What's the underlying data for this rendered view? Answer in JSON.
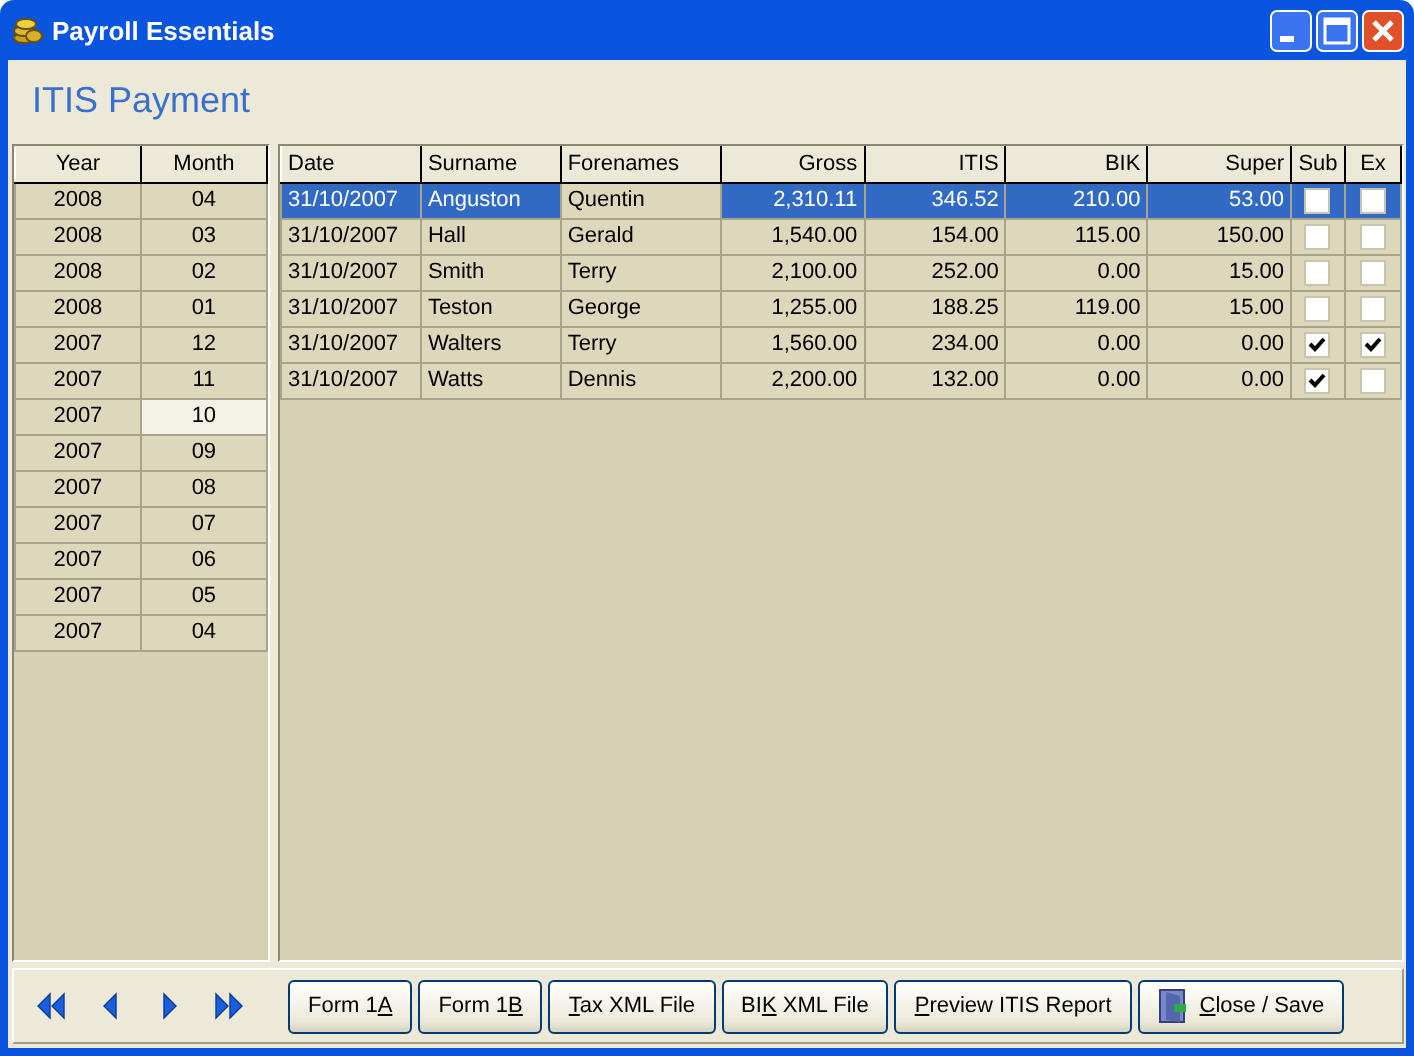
{
  "window": {
    "title": "Payroll Essentials"
  },
  "heading": "ITIS Payment",
  "periods": {
    "columns": [
      {
        "label": "Year",
        "focused": false
      },
      {
        "label": "Month",
        "focused": true
      }
    ],
    "rows": [
      {
        "cells": [
          "2008",
          "04"
        ],
        "selected": false
      },
      {
        "cells": [
          "2008",
          "03"
        ],
        "selected": false
      },
      {
        "cells": [
          "2008",
          "02"
        ],
        "selected": false
      },
      {
        "cells": [
          "2008",
          "01"
        ],
        "selected": false
      },
      {
        "cells": [
          "2007",
          "12"
        ],
        "selected": false
      },
      {
        "cells": [
          "2007",
          "11"
        ],
        "selected": false
      },
      {
        "cells": [
          "2007",
          "10"
        ],
        "selected": true
      },
      {
        "cells": [
          "2007",
          "09"
        ],
        "selected": false
      },
      {
        "cells": [
          "2007",
          "08"
        ],
        "selected": false
      },
      {
        "cells": [
          "2007",
          "07"
        ],
        "selected": false
      },
      {
        "cells": [
          "2007",
          "06"
        ],
        "selected": false
      },
      {
        "cells": [
          "2007",
          "05"
        ],
        "selected": false
      },
      {
        "cells": [
          "2007",
          "04"
        ],
        "selected": false
      }
    ]
  },
  "payments": {
    "columns": [
      {
        "label": "Date",
        "focused": false,
        "kind": "text"
      },
      {
        "label": "Surname",
        "focused": false,
        "kind": "text"
      },
      {
        "label": "Forenames",
        "focused": true,
        "kind": "text"
      },
      {
        "label": "Gross",
        "focused": false,
        "kind": "amount"
      },
      {
        "label": "ITIS",
        "focused": false,
        "kind": "amount"
      },
      {
        "label": "BIK",
        "focused": false,
        "kind": "amount"
      },
      {
        "label": "Super",
        "focused": false,
        "kind": "amount"
      },
      {
        "label": "Sub",
        "focused": false,
        "kind": "flag"
      },
      {
        "label": "Ex",
        "focused": false,
        "kind": "flag"
      }
    ],
    "rows": [
      {
        "cells": [
          "31/10/2007",
          "Anguston",
          "Quentin",
          "2,310.11",
          "346.52",
          "210.00",
          "53.00"
        ],
        "sub": false,
        "ex": false,
        "selected": true
      },
      {
        "cells": [
          "31/10/2007",
          "Hall",
          "Gerald",
          "1,540.00",
          "154.00",
          "115.00",
          "150.00"
        ],
        "sub": false,
        "ex": false,
        "selected": false
      },
      {
        "cells": [
          "31/10/2007",
          "Smith",
          "Terry",
          "2,100.00",
          "252.00",
          "0.00",
          "15.00"
        ],
        "sub": false,
        "ex": false,
        "selected": false
      },
      {
        "cells": [
          "31/10/2007",
          "Teston",
          "George",
          "1,255.00",
          "188.25",
          "119.00",
          "15.00"
        ],
        "sub": false,
        "ex": false,
        "selected": false
      },
      {
        "cells": [
          "31/10/2007",
          "Walters",
          "Terry",
          "1,560.00",
          "234.00",
          "0.00",
          "0.00"
        ],
        "sub": true,
        "ex": true,
        "selected": false
      },
      {
        "cells": [
          "31/10/2007",
          "Watts",
          "Dennis",
          "2,200.00",
          "132.00",
          "0.00",
          "0.00"
        ],
        "sub": true,
        "ex": false,
        "selected": false
      }
    ]
  },
  "buttons": [
    {
      "label": {
        "before": "Form 1",
        "key": "A"
      },
      "kind": "text"
    },
    {
      "label": {
        "before": "Form 1",
        "key": "B"
      },
      "kind": "text"
    },
    {
      "label": {
        "key": "T",
        "after": "ax XML File"
      },
      "kind": "text"
    },
    {
      "label": {
        "before": "BI",
        "key": "K",
        "after": " XML File"
      },
      "kind": "text"
    },
    {
      "label": {
        "key": "P",
        "after": "review ITIS Report"
      },
      "kind": "text"
    },
    {
      "label": {
        "key": "C",
        "after": "lose / Save"
      },
      "kind": "door"
    }
  ]
}
